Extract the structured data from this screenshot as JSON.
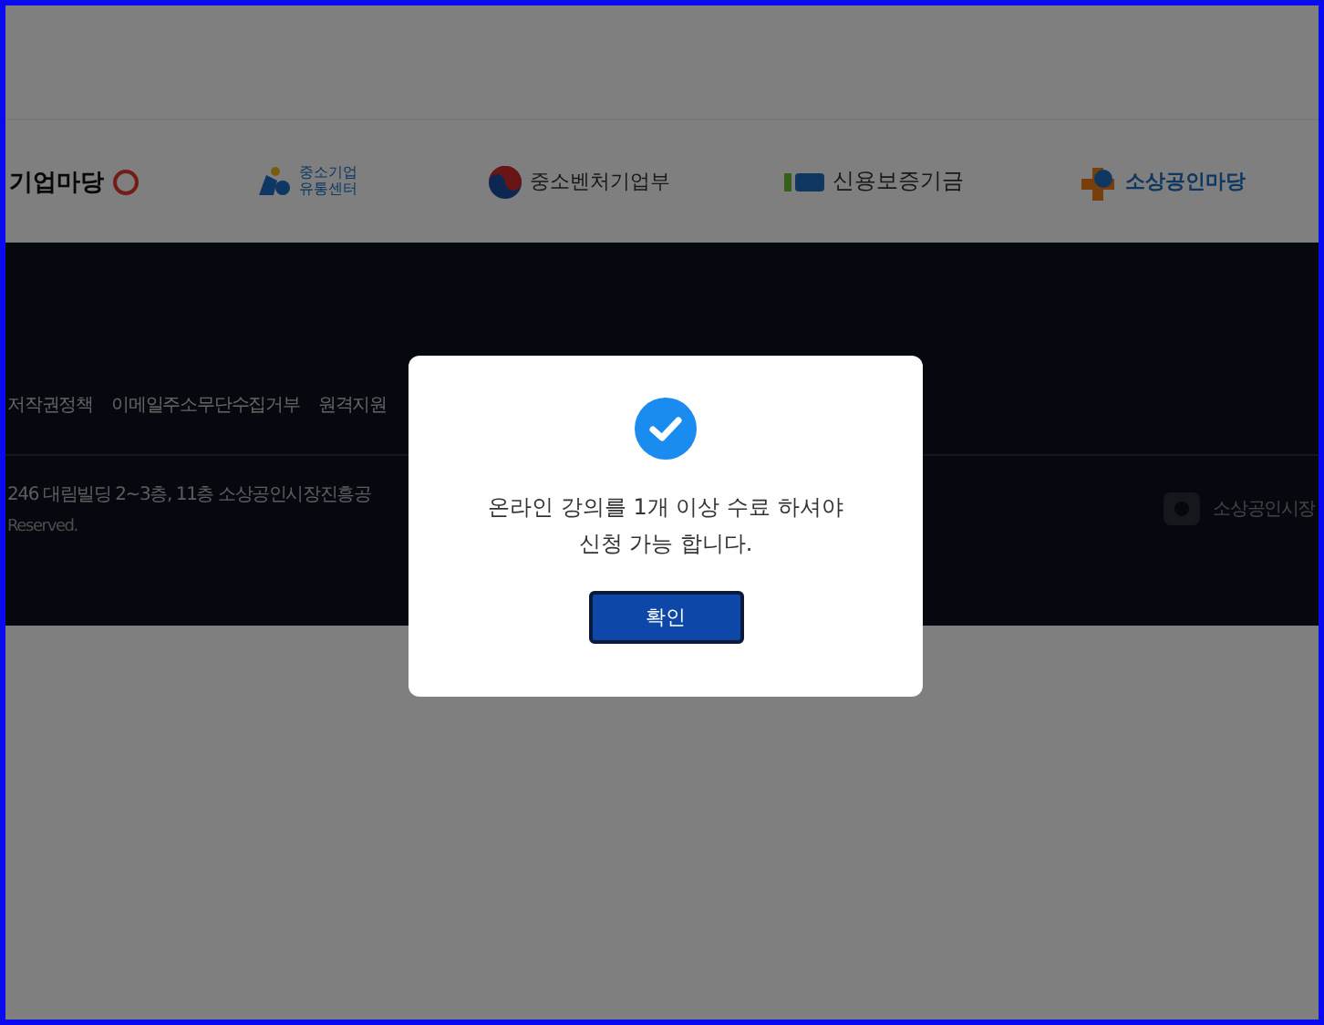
{
  "partner_logos": [
    {
      "kind": "gieop",
      "text": "기업마당"
    },
    {
      "kind": "drops",
      "text": "중소기업 유통센터"
    },
    {
      "kind": "taegeuk",
      "text": "중소벤처기업부"
    },
    {
      "kind": "kodit",
      "text": "신용보증기금"
    },
    {
      "kind": "cross",
      "text": "소상공인마당"
    }
  ],
  "footer": {
    "links": [
      "저작권정책",
      "이메일주소무단수집거부",
      "원격지원"
    ],
    "address": "246 대림빌딩 2~3층, 11층 소상공인시장진흥공",
    "copyright": "Reserved.",
    "org_logo": "소상공인시장"
  },
  "dialog": {
    "message": "온라인 강의를 1개 이상 수료 하셔야\n신청 가능 합니다.",
    "confirm": "확인"
  }
}
